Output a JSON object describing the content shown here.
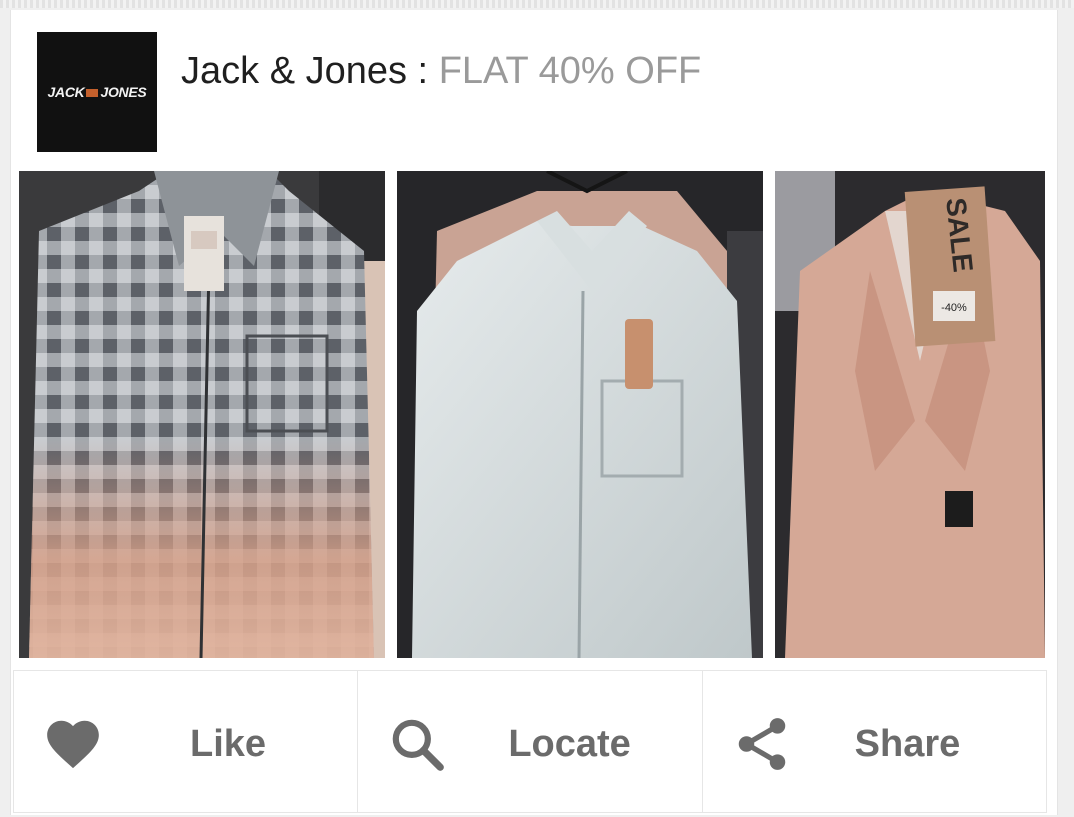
{
  "card": {
    "brand": "Jack & Jones",
    "separator": " : ",
    "offer": "FLAT 40% OFF",
    "logo": {
      "left_word": "JACK",
      "right_word": "JONES",
      "accent_color": "#c4602c"
    }
  },
  "photos": [
    {
      "subject": "checked dip-dye shirt on hanger"
    },
    {
      "subject": "light grey linen shirt with tag"
    },
    {
      "subject": "peach linen blazer with sale tag",
      "tag_text": "SALE",
      "tag_discount": "-40%"
    }
  ],
  "actions": {
    "like": {
      "label": "Like",
      "icon": "heart-icon"
    },
    "locate": {
      "label": "Locate",
      "icon": "search-icon"
    },
    "share": {
      "label": "Share",
      "icon": "share-icon"
    }
  },
  "colors": {
    "title": "#1f1f1f",
    "offer": "#9a9a9a",
    "action_text": "#6b6b6b"
  }
}
